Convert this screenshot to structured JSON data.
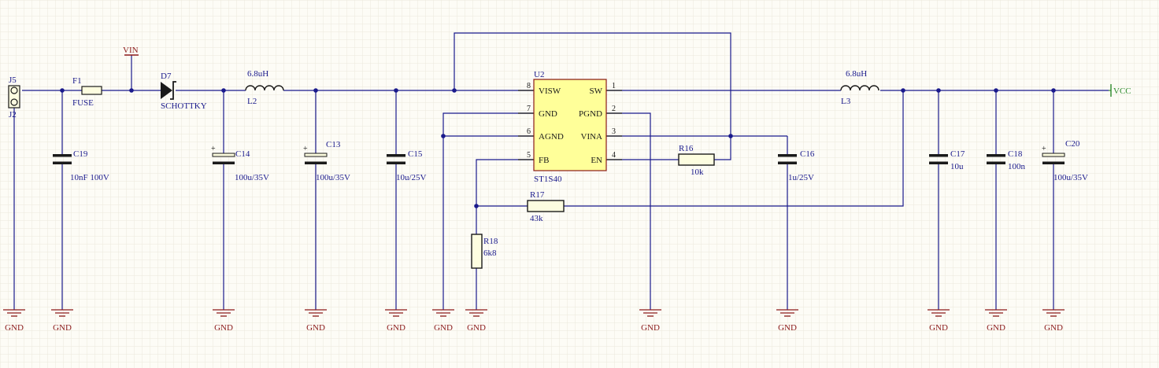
{
  "colors": {
    "background": "#fdfcf6",
    "grid": "#ece9dc",
    "wire": "#1a1a8c",
    "label": "#1a1a8c",
    "power": "#8b1a1a",
    "net_vcc": "#2e8b2e",
    "ic_fill": "#ffff99",
    "ic_border": "#8b1a1a",
    "part_border": "#8b1a1a",
    "part_fill": "#fdfde0",
    "pin_number": "#1a1a1a",
    "component": "#1a1a1a"
  },
  "power_labels": {
    "vin": "VIN",
    "vcc": "VCC",
    "gnd": "GND"
  },
  "connector": {
    "ref_top": "J5",
    "ref_bottom": "J2"
  },
  "fuse": {
    "ref": "F1",
    "value": "FUSE"
  },
  "diode": {
    "ref": "D7",
    "value": "SCHOTTKY"
  },
  "inductors": {
    "l2": {
      "ref": "L2",
      "value": "6.8uH"
    },
    "l3": {
      "ref": "L3",
      "value": "6.8uH"
    }
  },
  "capacitors": {
    "c19": {
      "ref": "C19",
      "value": "10nF 100V"
    },
    "c14": {
      "ref": "C14",
      "value": "100u/35V"
    },
    "c13": {
      "ref": "C13",
      "value": "100u/35V"
    },
    "c15": {
      "ref": "C15",
      "value": "10u/25V"
    },
    "c16": {
      "ref": "C16",
      "value": "1u/25V"
    },
    "c17": {
      "ref": "C17",
      "value": "10u"
    },
    "c18": {
      "ref": "C18",
      "value": "100n"
    },
    "c20": {
      "ref": "C20",
      "value": "100u/35V"
    }
  },
  "resistors": {
    "r16": {
      "ref": "R16",
      "value": "10k"
    },
    "r17": {
      "ref": "R17",
      "value": "43k"
    },
    "r18": {
      "ref": "R18",
      "value": "6k8"
    }
  },
  "ic": {
    "ref": "U2",
    "part": "ST1S40",
    "pins": {
      "visw": {
        "name": "VISW",
        "num": "8"
      },
      "gnd": {
        "name": "GND",
        "num": "7"
      },
      "agnd": {
        "name": "AGND",
        "num": "6"
      },
      "fb": {
        "name": "FB",
        "num": "5"
      },
      "sw": {
        "name": "SW",
        "num": "1"
      },
      "pgnd": {
        "name": "PGND",
        "num": "2"
      },
      "vina": {
        "name": "VINA",
        "num": "3"
      },
      "en": {
        "name": "EN",
        "num": "4"
      }
    }
  }
}
